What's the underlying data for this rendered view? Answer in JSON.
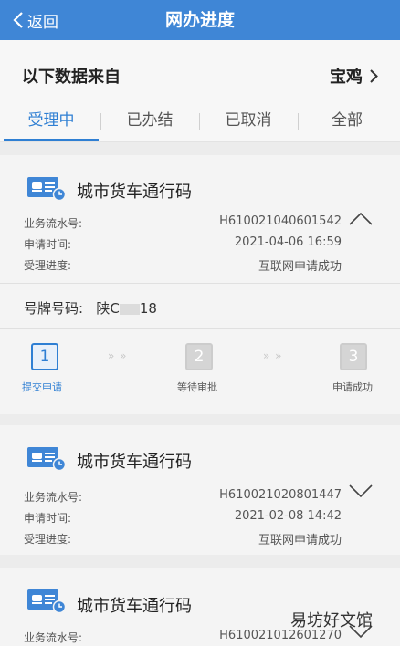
{
  "header": {
    "back_label": "返回",
    "title": "网办进度"
  },
  "source": {
    "label": "以下数据来自",
    "city": "宝鸡"
  },
  "tabs": [
    {
      "label": "受理中",
      "active": true
    },
    {
      "label": "已办结",
      "active": false
    },
    {
      "label": "已取消",
      "active": false
    },
    {
      "label": "全部",
      "active": false
    }
  ],
  "cards": [
    {
      "title": "城市货车通行码",
      "serial_label": "业务流水号:",
      "serial": "H610021040601542",
      "time_label": "申请时间:",
      "time": "2021-04-06 16:59",
      "progress_label": "受理进度:",
      "progress": "互联网申请成功",
      "expanded": true
    },
    {
      "title": "城市货车通行码",
      "serial_label": "业务流水号:",
      "serial": "H610021020801447",
      "time_label": "申请时间:",
      "time": "2021-02-08 14:42",
      "progress_label": "受理进度:",
      "progress": "互联网申请成功",
      "expanded": false
    },
    {
      "title": "城市货车通行码",
      "serial_label": "业务流水号:",
      "serial": "H610021012601270",
      "expanded": false
    }
  ],
  "plate": {
    "label": "号牌号码:",
    "prefix": "陕C",
    "suffix": "18"
  },
  "steps": [
    {
      "number": "1",
      "label": "提交申请",
      "active": true
    },
    {
      "number": "2",
      "label": "等待审批",
      "active": false
    },
    {
      "number": "3",
      "label": "申请成功",
      "active": false
    }
  ],
  "step_arrows": "» »",
  "watermark": "易坊好文馆",
  "colors": {
    "header": "#3f86d6",
    "accent": "#2f7fd3"
  }
}
